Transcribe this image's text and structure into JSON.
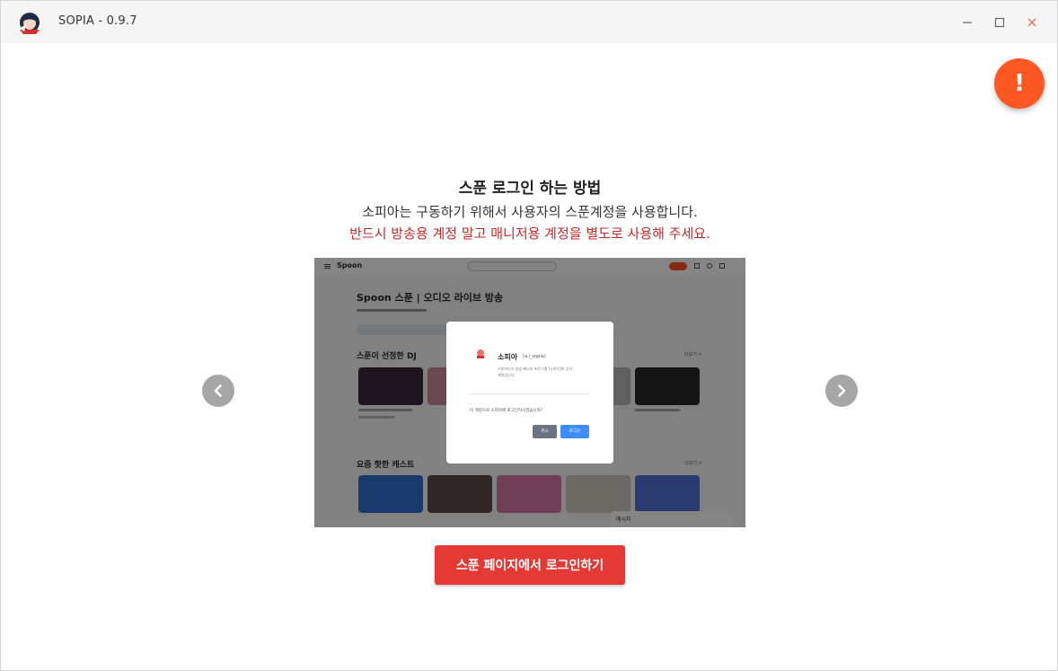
{
  "window": {
    "title": "SOPIA - 0.9.7",
    "controls": {
      "minimize_icon": "minimize-icon",
      "maximize_icon": "maximize-icon",
      "close_icon": "close-icon"
    }
  },
  "notice_button": {
    "icon": "exclamation-icon",
    "label": "!"
  },
  "guide": {
    "title": "스푼 로그인 하는 방법",
    "description": "소피아는 구동하기 위해서 사용자의 스푼계정을 사용합니다.",
    "warning": "반드시 방송용 계정 말고 매니저용 계정을 별도로 사용해 주세요."
  },
  "slide": {
    "brand": "Spoon",
    "heading": "Spoon 스푼 | 오디오 라이브 방송",
    "section_dj": "스푼이 선정한 DJ",
    "section_cast": "요즘 핫한 캐스트",
    "more_dj": "더보기 >",
    "more_cast": "더보기 >",
    "chat_label": "메시지",
    "dialog": {
      "app_name": "소피아",
      "app_handle": "(a.i_sopia)",
      "desc_line1": "스푼라디오 방송 매니저 프로그램 [소피아]의 공식",
      "desc_line2": "계정입니다.",
      "question": "이 계정으로 소피아에 로그인하시겠습니까?",
      "cancel_label": "취소",
      "confirm_label": "로그인"
    }
  },
  "carousel": {
    "prev_icon": "chevron-left-icon",
    "next_icon": "chevron-right-icon"
  },
  "login_button": {
    "label": "스푼 페이지에서 로그인하기"
  },
  "colors": {
    "accent": "#e53935",
    "fab": "#ff5722",
    "warning_text": "#c62828",
    "dialog_confirm": "#3f8ef7"
  }
}
